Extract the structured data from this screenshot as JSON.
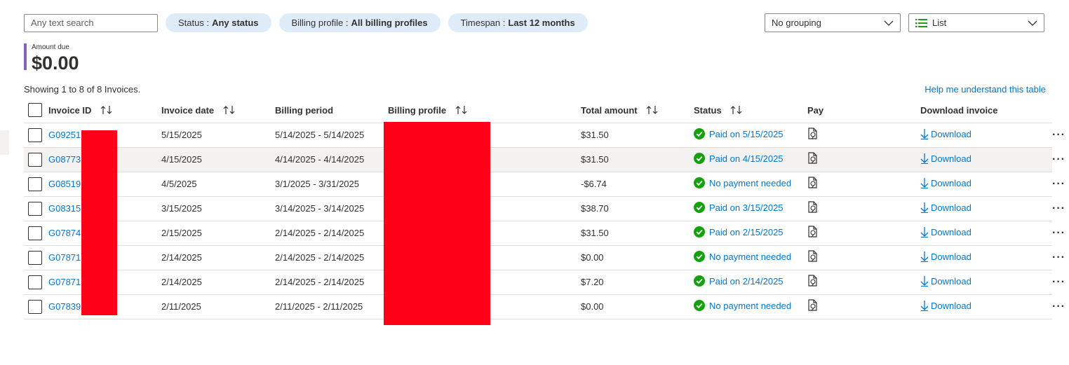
{
  "filters": {
    "search_placeholder": "Any text search",
    "status_label": "Status :",
    "status_value": "Any status",
    "billing_label": "Billing profile :",
    "billing_value": "All billing profiles",
    "timespan_label": "Timespan :",
    "timespan_value": "Last 12 months"
  },
  "grouping": {
    "selected": "No grouping"
  },
  "view": {
    "selected": "List"
  },
  "summary": {
    "amount_label": "Amount due",
    "amount_value": "$0.00",
    "showing_text": "Showing 1 to 8 of 8 Invoices.",
    "help_link": "Help me understand this table"
  },
  "table": {
    "columns": {
      "invoice_id": "Invoice ID",
      "invoice_date": "Invoice date",
      "billing_period": "Billing period",
      "billing_profile": "Billing profile",
      "total_amount": "Total amount",
      "status": "Status",
      "pay": "Pay",
      "download_invoice": "Download invoice"
    },
    "rows": [
      {
        "invoice_id": "G09251",
        "invoice_date": "5/15/2025",
        "billing_period": "5/14/2025 - 5/14/2025",
        "total_amount": "$31.50",
        "status": "Paid on 5/15/2025",
        "download": "Download"
      },
      {
        "invoice_id": "G08773",
        "invoice_date": "4/15/2025",
        "billing_period": "4/14/2025 - 4/14/2025",
        "total_amount": "$31.50",
        "status": "Paid on 4/15/2025",
        "download": "Download"
      },
      {
        "invoice_id": "G08519",
        "invoice_date": "4/5/2025",
        "billing_period": "3/1/2025 - 3/31/2025",
        "total_amount": "-$6.74",
        "status": "No payment needed",
        "download": "Download"
      },
      {
        "invoice_id": "G08315",
        "invoice_date": "3/15/2025",
        "billing_period": "3/14/2025 - 3/14/2025",
        "total_amount": "$38.70",
        "status": "Paid on 3/15/2025",
        "download": "Download"
      },
      {
        "invoice_id": "G07874",
        "invoice_date": "2/15/2025",
        "billing_period": "2/14/2025 - 2/14/2025",
        "total_amount": "$31.50",
        "status": "Paid on 2/15/2025",
        "download": "Download"
      },
      {
        "invoice_id": "G07871",
        "invoice_date": "2/14/2025",
        "billing_period": "2/14/2025 - 2/14/2025",
        "total_amount": "$0.00",
        "status": "No payment needed",
        "download": "Download"
      },
      {
        "invoice_id": "G07871",
        "invoice_date": "2/14/2025",
        "billing_period": "2/14/2025 - 2/14/2025",
        "total_amount": "$7.20",
        "status": "Paid on 2/14/2025",
        "download": "Download"
      },
      {
        "invoice_id": "G07839",
        "invoice_date": "2/11/2025",
        "billing_period": "2/11/2025 - 2/11/2025",
        "total_amount": "$0.00",
        "status": "No payment needed",
        "download": "Download"
      }
    ]
  },
  "icons": {
    "status": "check-circle-icon",
    "pay": "pay-document-icon",
    "download": "arrow-down-icon",
    "more": "more-horizontal-icon",
    "sort": "sort-icon",
    "chevron": "chevron-down-icon",
    "list": "list-icon"
  },
  "colors": {
    "accent": "#0078d4",
    "success": "#13a10e",
    "pill_bg": "#deecf9",
    "amount_bar": "#8661c5",
    "row_highlight": "#f3f2f1",
    "redaction": "#ff0019"
  },
  "highlighted_row": 1
}
